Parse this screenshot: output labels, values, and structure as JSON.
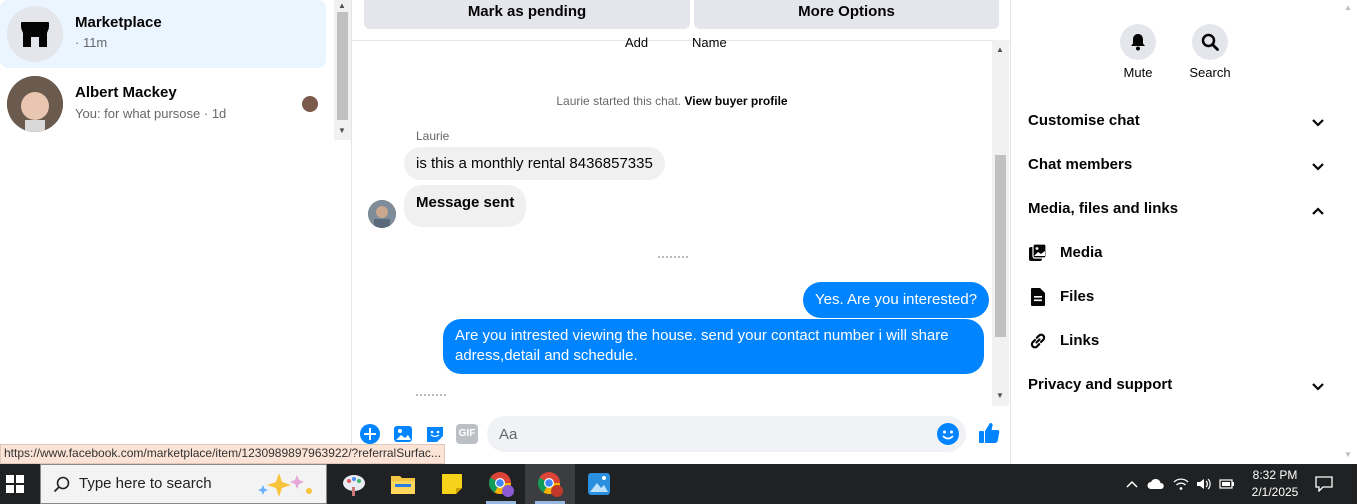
{
  "left_panel": {
    "conversations": [
      {
        "name": "Marketplace",
        "subtitle": "· 11m",
        "active": true
      },
      {
        "name": "Albert Mackey",
        "subtitle": "You: for what pursose · 1d",
        "active": false
      }
    ]
  },
  "top_buttons": {
    "pending": "Mark as pending",
    "more": "More Options"
  },
  "header_cut": {
    "add": "Add",
    "name": "Name"
  },
  "chat": {
    "started_text": "Laurie started this chat.",
    "view_profile": "View buyer profile",
    "sender_name": "Laurie",
    "incoming": [
      "is this a monthly rental 8436857335",
      "Message sent"
    ],
    "outgoing": [
      "Yes. Are you interested?",
      "Are you intrested viewing the house. send your contact number i will share adress,detail and schedule."
    ]
  },
  "composer": {
    "placeholder": "Aa",
    "gif_label": "GIF"
  },
  "right_panel": {
    "mute_label": "Mute",
    "search_label": "Search",
    "sections": {
      "customise": "Customise chat",
      "members": "Chat members",
      "media": "Media, files and links",
      "privacy": "Privacy and support"
    },
    "media_items": {
      "media": "Media",
      "files": "Files",
      "links": "Links"
    }
  },
  "status_url": "https://www.facebook.com/marketplace/item/1230989897963922/?referralSurfac...",
  "taskbar": {
    "search_placeholder": "Type here to search",
    "time": "8:32 PM",
    "date": "2/1/2025"
  },
  "colors": {
    "messenger_blue": "#0084ff",
    "active_conv": "#ebf5ff",
    "taskbar": "#1f2123"
  }
}
